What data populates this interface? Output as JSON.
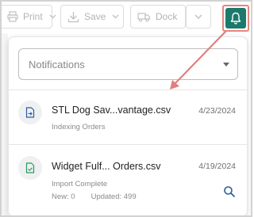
{
  "toolbar": {
    "print_label": "Print",
    "save_label": "Save",
    "dock_label": "Dock"
  },
  "notifications": {
    "filter_placeholder": "Notifications",
    "items": [
      {
        "title": "STL Dog Sav...vantage.csv",
        "date": "4/23/2024",
        "status": "Indexing Orders",
        "icon": "file-import-icon"
      },
      {
        "title": "Widget Fulf... Orders.csv",
        "date": "4/19/2024",
        "status": "Import Complete",
        "new_label": "New: 0",
        "updated_label": "Updated: 499",
        "icon": "file-check-icon"
      }
    ]
  },
  "colors": {
    "bell_bg": "#1c7a6c",
    "highlight": "#e8857c",
    "icon_blue": "#2d5d9f",
    "icon_green": "#2e9a5a"
  }
}
